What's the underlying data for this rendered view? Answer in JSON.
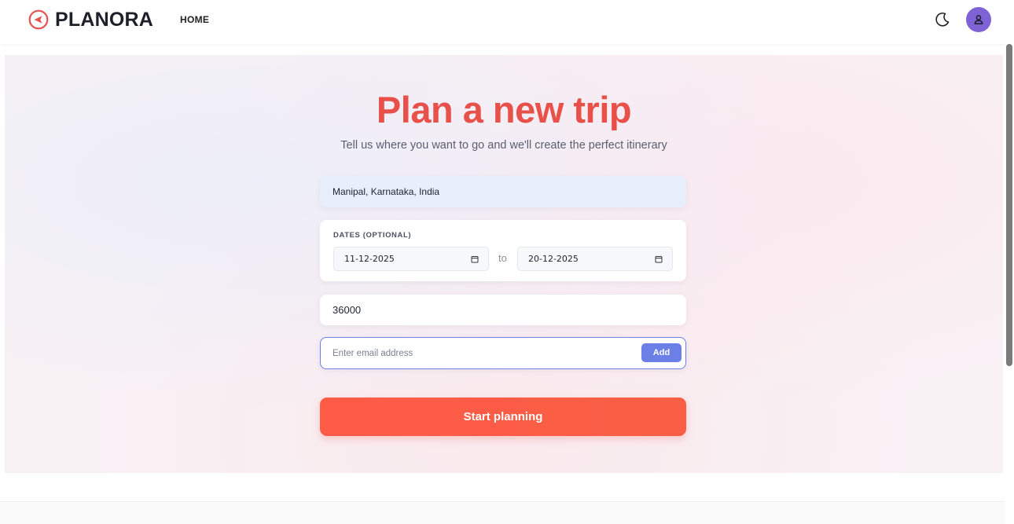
{
  "header": {
    "brand": "PLANORA",
    "nav_home": "HOME",
    "icons": {
      "logo": "compass-arrow-icon",
      "theme": "moon-icon",
      "user": "user-icon"
    },
    "colors": {
      "brand_accent": "#e8504a",
      "avatar_bg": "#7e62d6"
    }
  },
  "hero": {
    "title": "Plan a new trip",
    "subtitle": "Tell us where you want to go and we'll create the perfect itinerary"
  },
  "form": {
    "destination_value": "Manipal, Karnataka, India",
    "dates_label": "DATES (OPTIONAL)",
    "date_from": "11-12-2025",
    "date_to": "20-12-2025",
    "date_separator": "to",
    "budget_value": "36000",
    "email_placeholder": "Enter email address",
    "add_label": "Add",
    "submit_label": "Start planning",
    "colors": {
      "primary_button": "#ff5b47",
      "add_button": "#6c7fe6",
      "focus_border": "#6f80e6"
    }
  }
}
